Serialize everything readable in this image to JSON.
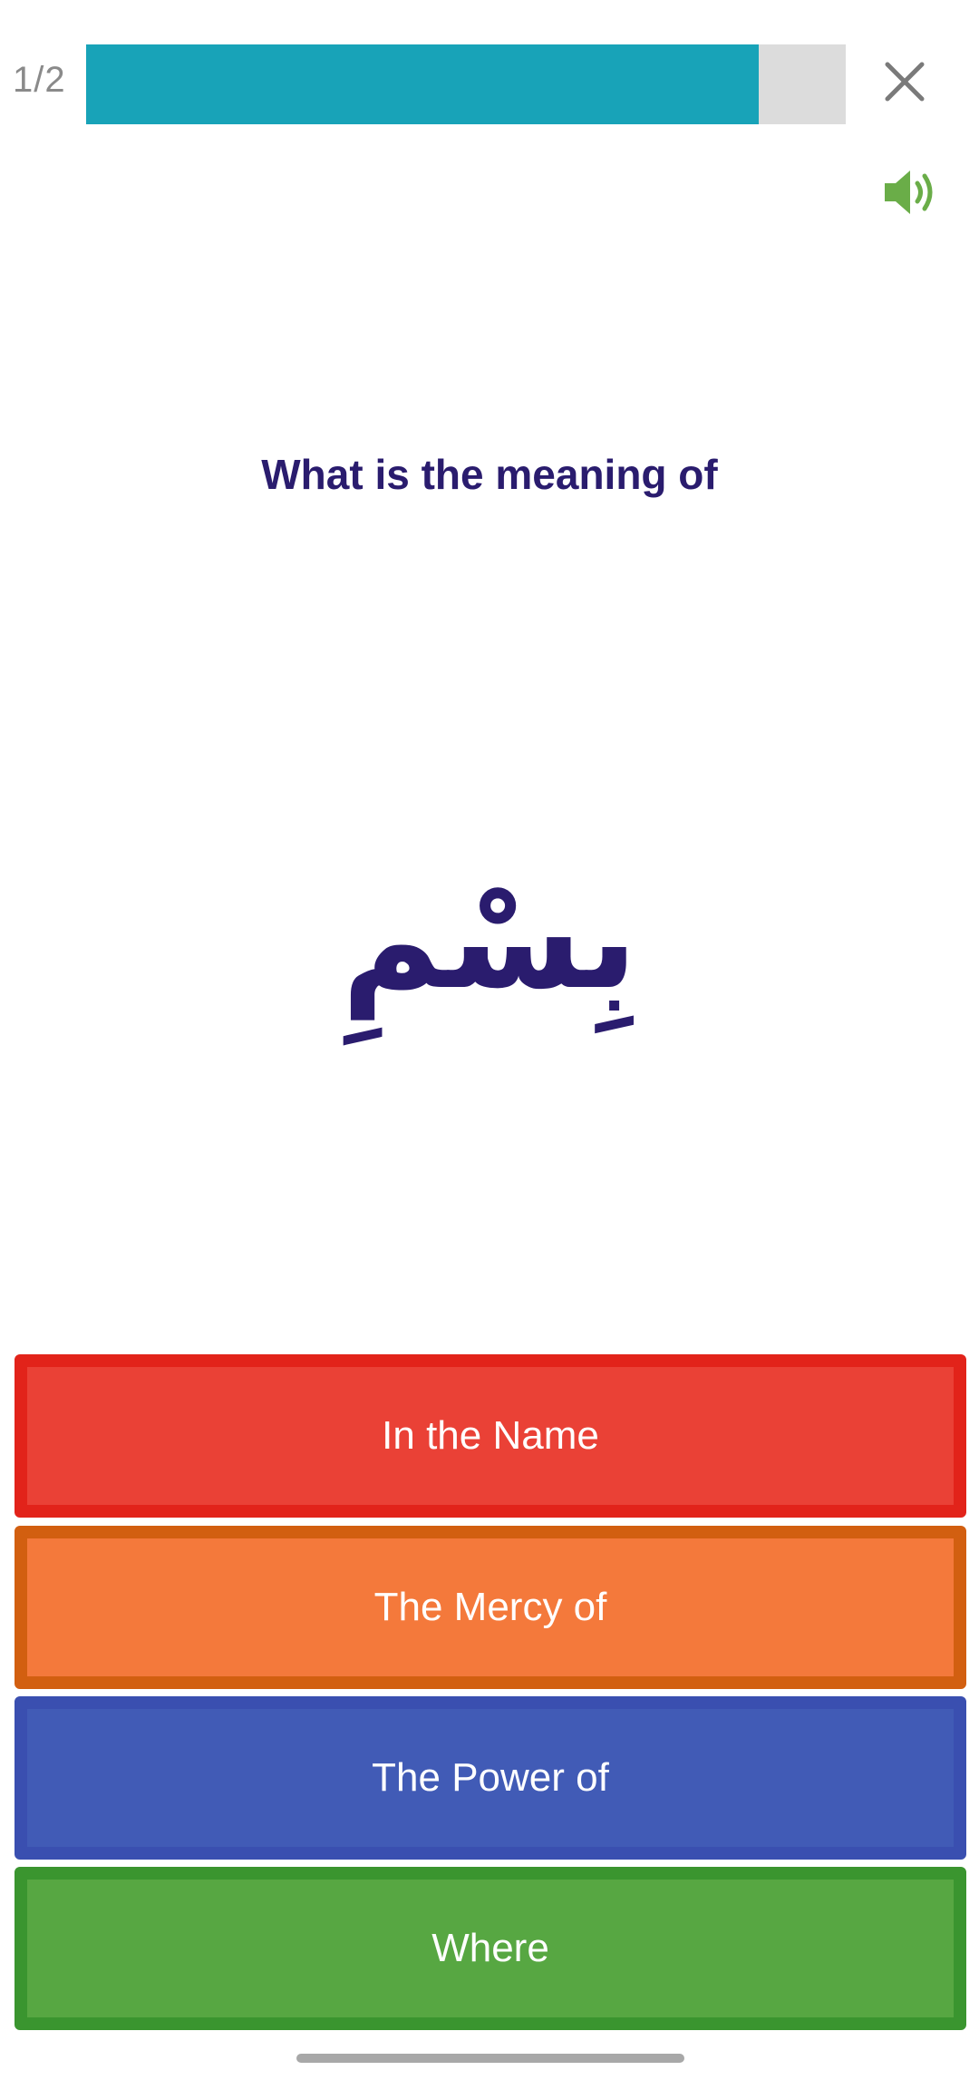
{
  "progress": {
    "counter_text": "1/2",
    "fraction": 0.886,
    "fill_color": "#18a3b8",
    "track_color": "#dcdcdc"
  },
  "header": {
    "close_icon": "close-icon",
    "sound_icon": "speaker-icon",
    "sound_color": "#6aad48"
  },
  "question": {
    "prompt": "What is the meaning of",
    "arabic_word": "بِسْمِ"
  },
  "answers": [
    {
      "label": "In the Name",
      "color": "#ea4136"
    },
    {
      "label": "The Mercy of",
      "color": "#f4793b"
    },
    {
      "label": "The Power of",
      "color": "#415bb6"
    },
    {
      "label": "Where",
      "color": "#57a742"
    }
  ]
}
